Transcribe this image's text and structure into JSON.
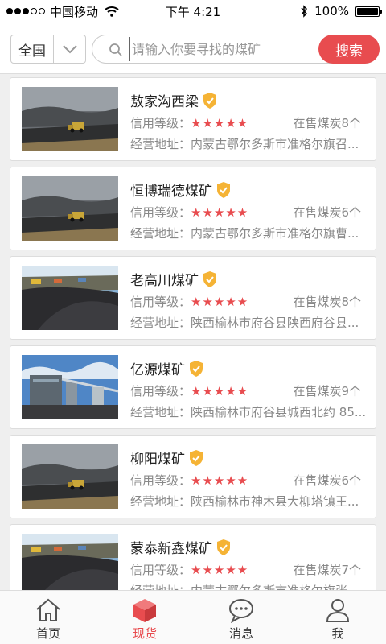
{
  "status_bar": {
    "carrier": "中国移动",
    "time": "下午 4:21",
    "battery": "100%"
  },
  "search": {
    "region": "全国",
    "placeholder": "请输入你要寻找的煤矿",
    "button_label": "搜索"
  },
  "labels": {
    "rating": "信用等级：",
    "address": "经营地址："
  },
  "mines": [
    {
      "name": "敖家沟西梁",
      "stars": "★★★★★",
      "stock": "在售煤炭8个",
      "address": "内蒙古鄂尔多斯市准格尔旗召...",
      "image": "coal-truck-photo"
    },
    {
      "name": "恒博瑞德煤矿",
      "stars": "★★★★★",
      "stock": "在售煤炭6个",
      "address": "内蒙古鄂尔多斯市准格尔旗曹...",
      "image": "coal-truck-photo"
    },
    {
      "name": "老高川煤矿",
      "stars": "★★★★★",
      "stock": "在售煤炭8个",
      "address": "陕西榆林市府谷县陕西府谷县...",
      "image": "coal-pile-photo"
    },
    {
      "name": "亿源煤矿",
      "stars": "★★★★★",
      "stock": "在售煤炭9个",
      "address": "陕西榆林市府谷县城西北约 85...",
      "image": "coal-plant-photo"
    },
    {
      "name": "柳阳煤矿",
      "stars": "★★★★★",
      "stock": "在售煤炭6个",
      "address": "陕西榆林市神木县大柳塔镇王...",
      "image": "coal-truck-photo"
    },
    {
      "name": "蒙泰新鑫煤矿",
      "stars": "★★★★★",
      "stock": "在售煤炭7个",
      "address": "内蒙古鄂尔多斯市准格尔旗张...",
      "image": "coal-pile-photo"
    }
  ],
  "tabs": [
    {
      "label": "首页",
      "icon": "home-icon",
      "active": false
    },
    {
      "label": "现货",
      "icon": "cube-icon",
      "active": true
    },
    {
      "label": "消息",
      "icon": "message-icon",
      "active": false
    },
    {
      "label": "我",
      "icon": "user-icon",
      "active": false
    }
  ],
  "colors": {
    "accent": "#e84c4f",
    "star": "#e84c4f",
    "verify_badge": "#f5b335"
  }
}
